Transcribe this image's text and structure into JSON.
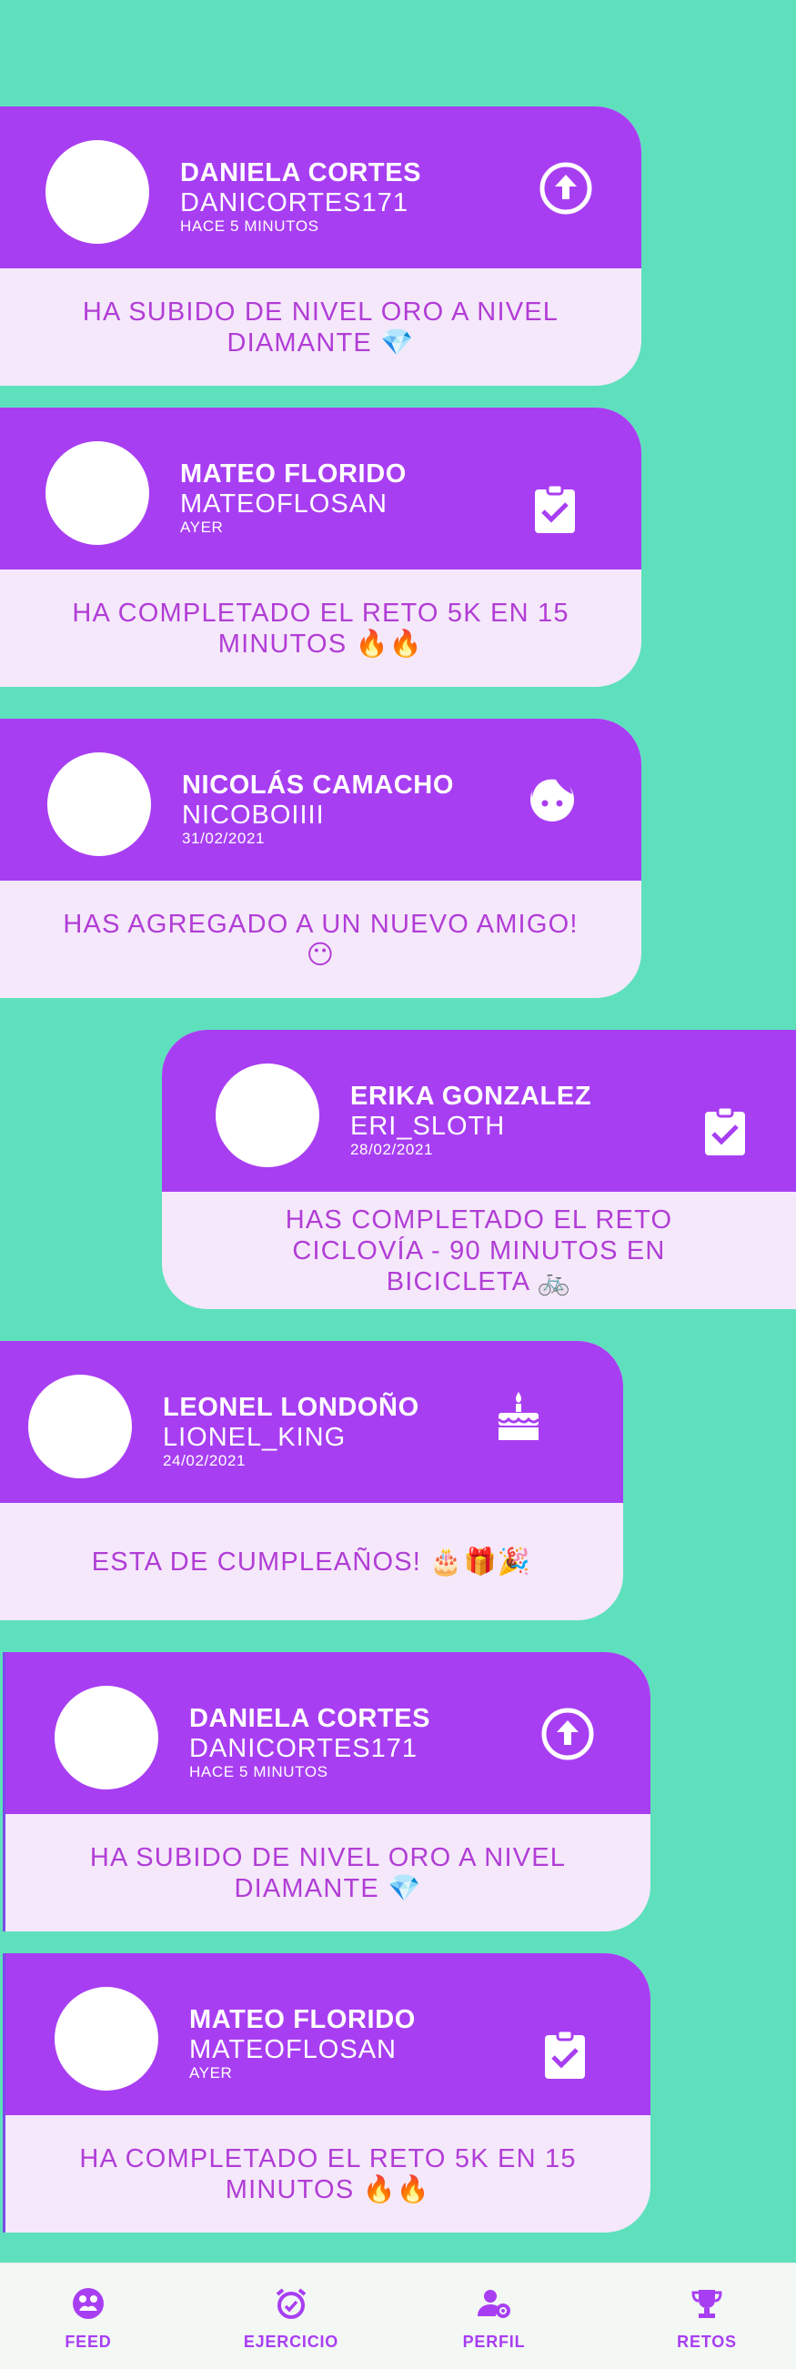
{
  "feed": [
    {
      "name": "DANIELA CORTES",
      "user": "DANICORTES171",
      "time": "HACE 5 MINUTOS",
      "icon": "arrow-circle-up-icon",
      "message": "HA SUBIDO DE NIVEL ORO A NIVEL DIAMANTE 💎"
    },
    {
      "name": "MATEO FLORIDO",
      "user": "MATEOFLOSAN",
      "time": "AYER",
      "icon": "clipboard-check-icon",
      "message": "HA COMPLETADO EL RETO 5K EN 15 MINUTOS 🔥🔥"
    },
    {
      "name": "NICOLÁS CAMACHO",
      "user": "NICOBOIIII",
      "time": "31/02/2021",
      "icon": "face-icon",
      "message": "HAS AGREGADO A UN NUEVO AMIGO! 😶"
    },
    {
      "name": "ERIKA GONZALEZ",
      "user": "ERI_SLOTH",
      "time": "28/02/2021",
      "icon": "clipboard-check-icon",
      "message": "HAS COMPLETADO EL RETO CICLOVÍA - 90 MINUTOS EN BICICLETA 🚲"
    },
    {
      "name": "LEONEL LONDOÑO",
      "user": "LIONEL_KING",
      "time": "24/02/2021",
      "icon": "cake-icon",
      "message": "ESTA DE CUMPLEAÑOS! 🎂🎁🎉"
    },
    {
      "name": "DANIELA CORTES",
      "user": "DANICORTES171",
      "time": "HACE 5 MINUTOS",
      "icon": "arrow-circle-up-icon",
      "message": "HA SUBIDO DE NIVEL ORO A NIVEL DIAMANTE 💎"
    },
    {
      "name": "MATEO FLORIDO",
      "user": "MATEOFLOSAN",
      "time": "AYER",
      "icon": "clipboard-check-icon",
      "message": "HA COMPLETADO EL RETO 5K EN 15 MINUTOS 🔥🔥"
    }
  ],
  "nav": [
    {
      "label": "FEED",
      "icon": "feed-icon"
    },
    {
      "label": "EJERCICIO",
      "icon": "alarm-clock-icon"
    },
    {
      "label": "PERFIL",
      "icon": "user-settings-icon"
    },
    {
      "label": "RETOS",
      "icon": "trophy-icon"
    }
  ],
  "colors": {
    "background": "#5fe0bd",
    "card_header": "#a83ef2",
    "card_body": "#f5e8fb",
    "message_text": "#b13dd6",
    "nav_accent": "#a83ef2"
  }
}
